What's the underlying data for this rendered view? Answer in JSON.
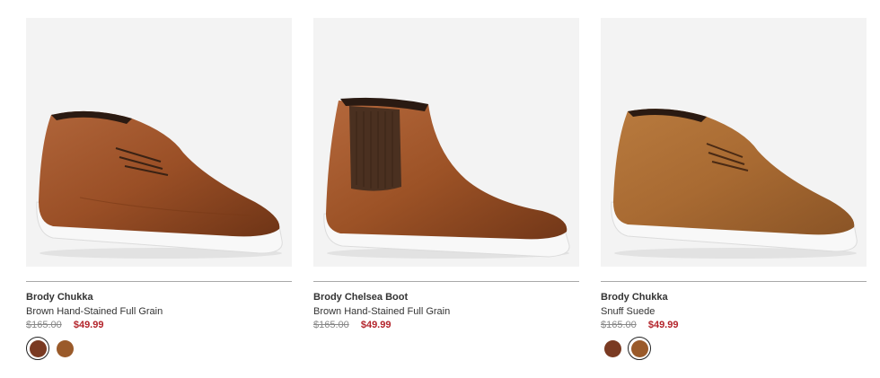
{
  "products": [
    {
      "name": "Brody Chukka",
      "color_name": "Brown Hand-Stained Full Grain",
      "original_price": "$165.00",
      "sale_price": "$49.99",
      "swatches": [
        {
          "color": "#7a3a22",
          "selected": true
        },
        {
          "color": "#9a5a2a",
          "selected": false
        }
      ]
    },
    {
      "name": "Brody Chelsea Boot",
      "color_name": "Brown Hand-Stained Full Grain",
      "original_price": "$165.00",
      "sale_price": "$49.99",
      "swatches": []
    },
    {
      "name": "Brody Chukka",
      "color_name": "Snuff Suede",
      "original_price": "$165.00",
      "sale_price": "$49.99",
      "swatches": [
        {
          "color": "#7a3a22",
          "selected": false
        },
        {
          "color": "#9a5a2a",
          "selected": true
        }
      ]
    }
  ]
}
